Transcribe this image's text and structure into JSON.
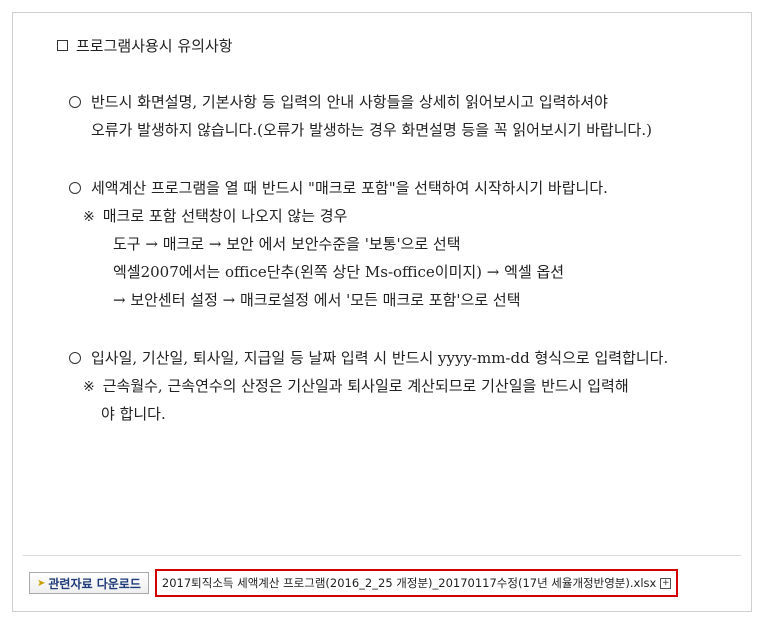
{
  "heading": "프로그램사용시 유의사항",
  "notes": [
    {
      "lines": [
        "반드시 화면설명, 기본사항 등 입력의 안내 사항들을 상세히 읽어보시고 입력하셔야",
        "오류가 발생하지 않습니다.(오류가 발생하는 경우 화면설명 등을 꼭 읽어보시기 바랍니다.)"
      ]
    },
    {
      "lines": [
        "세액계산 프로그램을 열 때 반드시 \"매크로 포함\"을 선택하여 시작하시기 바랍니다.",
        "매크로 포함 선택창이 나오지 않는 경우",
        "도구 → 매크로 → 보안 에서 보안수준을 '보통'으로 선택",
        "엑셀2007에서는 office단추(왼쪽 상단 Ms-office이미지) → 엑셀 옵션",
        "→ 보안센터 설정 → 매크로설정 에서 '모든 매크로 포함'으로 선택"
      ]
    },
    {
      "lines": [
        "입사일, 기산일, 퇴사일, 지급일 등 날짜 입력 시 반드시 yyyy-mm-dd 형식으로 입력합니다.",
        "근속월수, 근속연수의 산정은 기산일과 퇴사일로 계산되므로 기산일을 반드시 입력해",
        "야 합니다."
      ]
    }
  ],
  "reference_mark": "※",
  "footer": {
    "download_label": "관련자료 다운로드",
    "file_name": "2017퇴직소득 세액계산 프로그램(2016_2_25 개정분)_20170117수정(17년 세율개정반영분).xlsx"
  },
  "colors": {
    "highlight_border": "#d20000",
    "button_text": "#1f3b7a"
  }
}
